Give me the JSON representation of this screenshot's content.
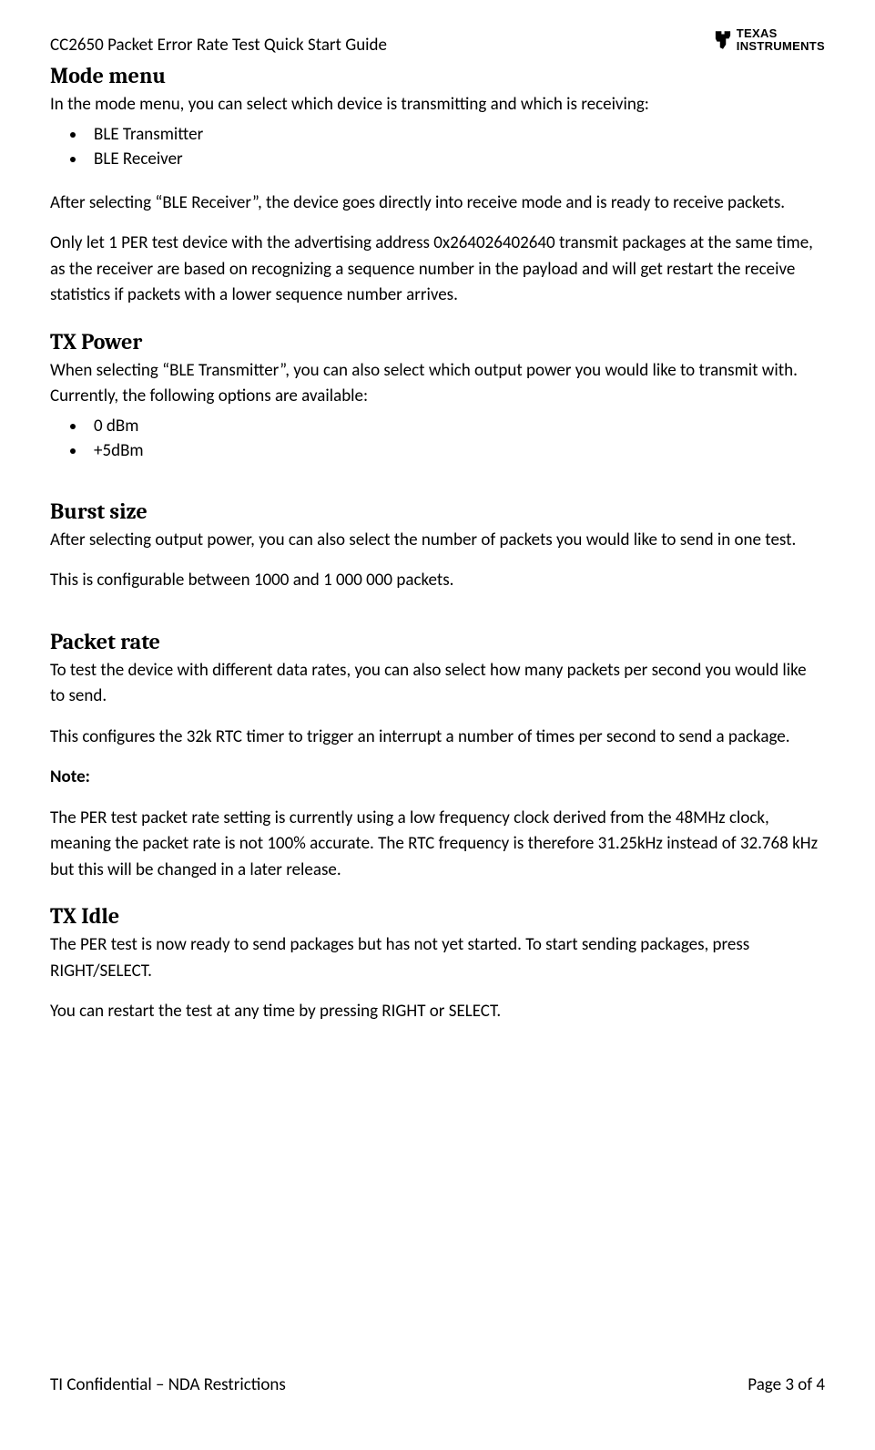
{
  "header": {
    "title": "CC2650 Packet Error Rate Test Quick Start Guide",
    "logo_line1": "TEXAS",
    "logo_line2": "INSTRUMENTS"
  },
  "sections": {
    "mode_menu": {
      "heading": "Mode menu",
      "intro": "In the mode menu, you can select which device is transmitting and which is receiving:",
      "items": [
        "BLE Transmitter",
        "BLE Receiver"
      ],
      "para1": "After selecting “BLE Receiver”, the device goes directly into receive mode and is ready to receive packets.",
      "para2": "Only let 1 PER test device with the advertising address 0x264026402640 transmit packages at the same time, as the receiver are based on recognizing a sequence number in the payload and will get restart the receive statistics if packets with a lower sequence number arrives."
    },
    "tx_power": {
      "heading": "TX Power",
      "intro": "When selecting “BLE Transmitter”, you can also select which output power you would like to transmit with. Currently, the following options are available:",
      "items": [
        "0 dBm",
        "+5dBm"
      ]
    },
    "burst_size": {
      "heading": "Burst size",
      "para1": "After selecting output power, you can also select the number of packets you would like to send in one test.",
      "para2": "This is configurable between 1000 and 1 000 000 packets."
    },
    "packet_rate": {
      "heading": "Packet rate",
      "para1": "To test the device with different data rates, you can also select how many packets per second you would like to send.",
      "para2": "This configures the 32k RTC timer to trigger an interrupt a number of times per second to send a package.",
      "note_label": "Note:",
      "note_body": "The PER test packet rate setting is currently using a low frequency clock derived from the 48MHz clock, meaning the packet rate is not 100% accurate. The RTC frequency is therefore 31.25kHz instead of 32.768 kHz but this will be changed in a later release."
    },
    "tx_idle": {
      "heading": "TX Idle",
      "para1": "The PER test is now ready to send packages but has not yet started. To start sending packages, press RIGHT/SELECT.",
      "para2": "You can restart the test at any time by pressing RIGHT or SELECT."
    }
  },
  "footer": {
    "left": "TI Confidential – NDA Restrictions",
    "right": "Page 3 of 4"
  }
}
